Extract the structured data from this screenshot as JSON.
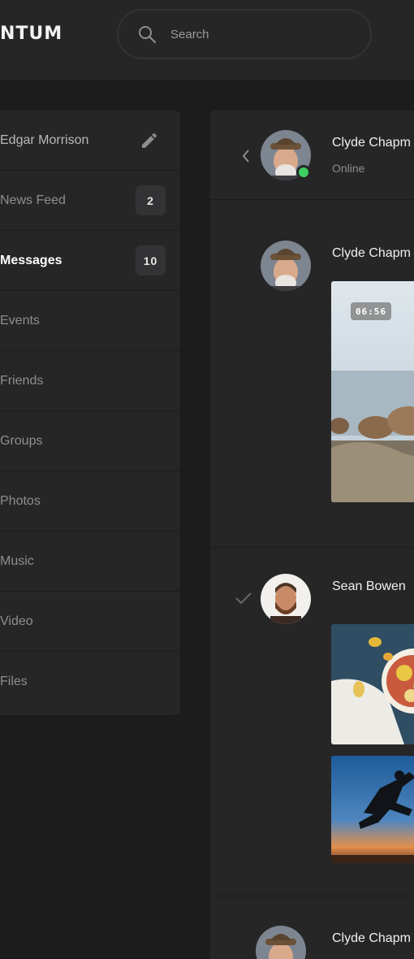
{
  "app": {
    "logo": "NTUM"
  },
  "search": {
    "placeholder": "Search",
    "icon": "search-icon"
  },
  "sidebar": {
    "profile": {
      "name": "Edgar Morrison",
      "icon": "pencil-icon"
    },
    "items": [
      {
        "label": "News Feed",
        "badge": "2"
      },
      {
        "label": "Messages",
        "badge": "10",
        "active": true
      },
      {
        "label": "Events"
      },
      {
        "label": "Friends"
      },
      {
        "label": "Groups"
      },
      {
        "label": "Photos"
      },
      {
        "label": "Music"
      },
      {
        "label": "Video"
      },
      {
        "label": "Files"
      }
    ]
  },
  "chat": {
    "header": {
      "name": "Clyde Chapm",
      "status": "Online",
      "back_icon": "chevron-left-icon",
      "status_color": "#3ecf63"
    },
    "messages": [
      {
        "sender": "Clyde Chapm",
        "video_duration": "06:56"
      },
      {
        "sender": "Sean Bowen",
        "icon": "check-icon"
      },
      {
        "sender": "Clyde Chapm"
      }
    ]
  },
  "colors": {
    "background": "#1c1c1d",
    "panel": "#262627",
    "badge": "#333335",
    "online": "#3ecf63"
  }
}
